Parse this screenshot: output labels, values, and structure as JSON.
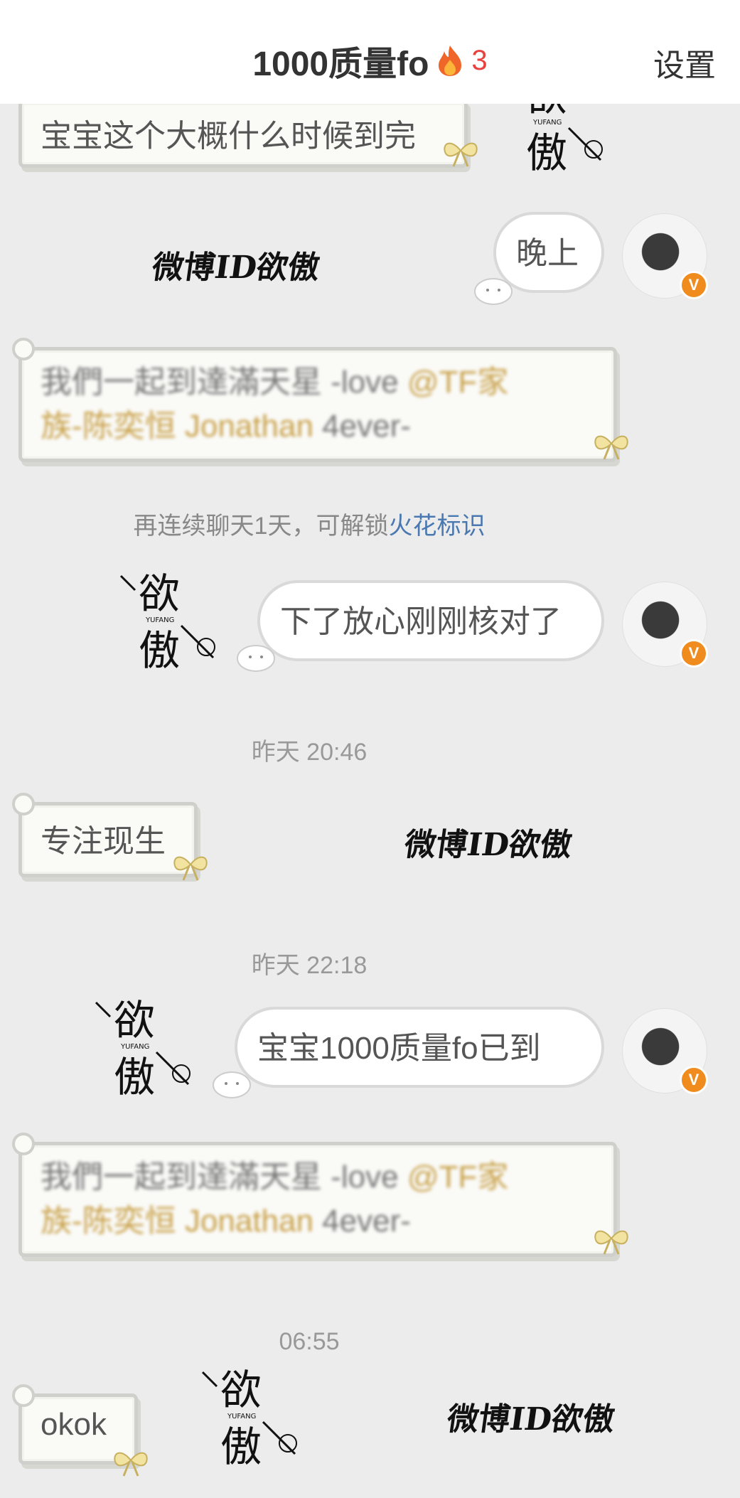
{
  "header": {
    "title": "1000质量fo",
    "streak_count": "3",
    "settings_label": "设置"
  },
  "messages": [
    {
      "text": "宝宝这个大概什么时候到完"
    },
    {
      "text": "晚上"
    },
    {
      "line1": "我們一起到達滿天星 -love ",
      "mention1": "@TF家",
      "mention2": "族-陈奕恒 Jonathan",
      "line2": "  4ever-"
    },
    {
      "text": "下了放心刚刚核对了"
    },
    {
      "text": "专注现生"
    },
    {
      "text": "宝宝1000质量fo已到"
    },
    {
      "line1": "我們一起到達滿天星 -love ",
      "mention1": "@TF家",
      "mention2": "族-陈奕恒 Jonathan",
      "line2": "  4ever-"
    },
    {
      "text": "okok"
    }
  ],
  "notice": {
    "text": "再连续聊天1天，可解锁",
    "link": "火花标识"
  },
  "timestamps": [
    "昨天 20:46",
    "昨天 22:18",
    "06:55"
  ],
  "watermark": "微博ID欲傲",
  "logo_text": {
    "top": "欲",
    "bottom": "傲",
    "sub": "YUFANG"
  },
  "colors": {
    "accent_link": "#4a78b0",
    "streak_red": "#e8423f",
    "badge_orange": "#f08c1e"
  },
  "icons": [
    "flame-icon",
    "verified-badge-icon",
    "ribbon-bow-icon",
    "cat-sticker-icon"
  ]
}
